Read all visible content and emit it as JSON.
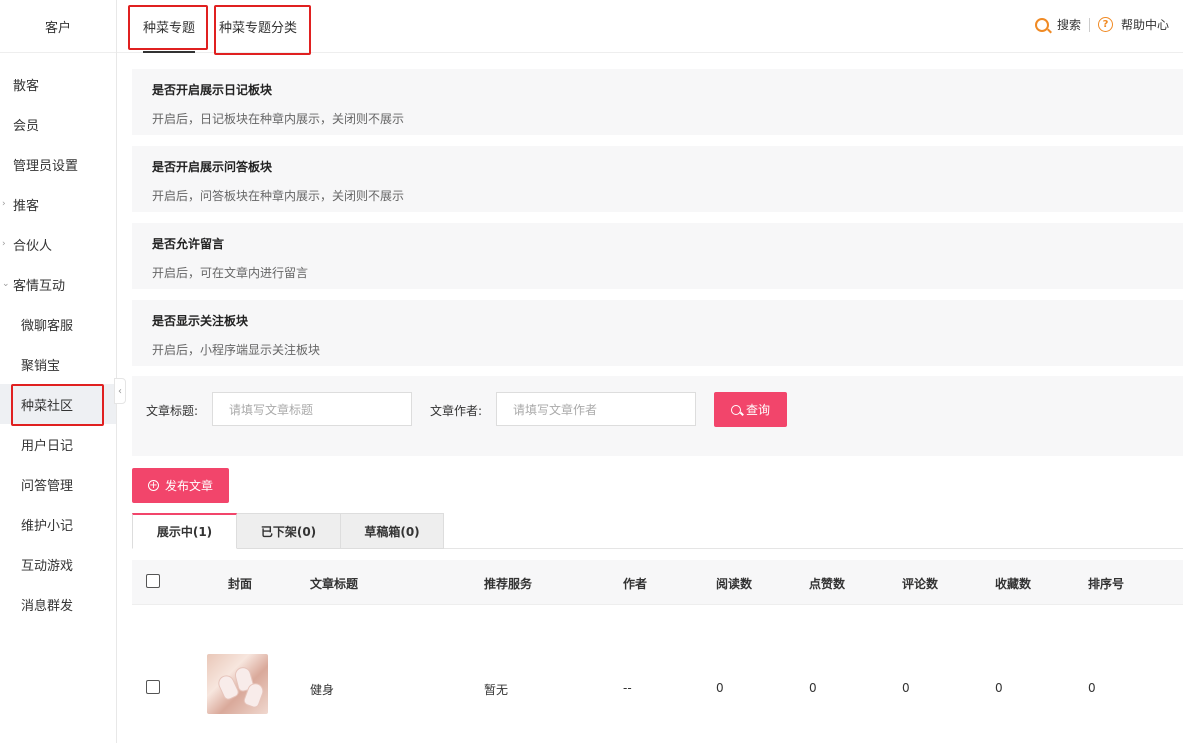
{
  "sidebar": {
    "title": "客户",
    "items": [
      {
        "label": "散客"
      },
      {
        "label": "会员"
      },
      {
        "label": "管理员设置"
      },
      {
        "label": "推客"
      },
      {
        "label": "合伙人"
      },
      {
        "label": "客情互动"
      },
      {
        "label": "微聊客服"
      },
      {
        "label": "聚销宝"
      },
      {
        "label": "种菜社区"
      },
      {
        "label": "用户日记"
      },
      {
        "label": "问答管理"
      },
      {
        "label": "维护小记"
      },
      {
        "label": "互动游戏"
      },
      {
        "label": "消息群发"
      }
    ]
  },
  "topbar": {
    "tabs": [
      {
        "label": "种菜专题"
      },
      {
        "label": "种菜专题分类"
      }
    ],
    "search_label": "搜索",
    "help_label": "帮助中心"
  },
  "settings": [
    {
      "title": "是否开启展示日记板块",
      "desc": "开启后，日记板块在种章内展示，关闭则不展示"
    },
    {
      "title": "是否开启展示问答板块",
      "desc": "开启后，问答板块在种章内展示，关闭则不展示"
    },
    {
      "title": "是否允许留言",
      "desc": "开启后，可在文章内进行留言"
    },
    {
      "title": "是否显示关注板块",
      "desc": "开启后，小程序端显示关注板块"
    }
  ],
  "search": {
    "title_label": "文章标题:",
    "title_placeholder": "请填写文章标题",
    "author_label": "文章作者:",
    "author_placeholder": "请填写文章作者",
    "query_label": "查询"
  },
  "publish_label": "发布文章",
  "tabs": [
    {
      "label": "展示中(1)"
    },
    {
      "label": "已下架(0)"
    },
    {
      "label": "草稿箱(0)"
    }
  ],
  "table": {
    "headers": [
      "封面",
      "文章标题",
      "推荐服务",
      "作者",
      "阅读数",
      "点赞数",
      "评论数",
      "收藏数",
      "排序号"
    ],
    "rows": [
      {
        "title": "健身",
        "service": "暂无",
        "author": "--",
        "reads": "0",
        "likes": "0",
        "comments": "0",
        "favorites": "0",
        "sort": "0"
      }
    ]
  },
  "colors": {
    "accent": "#f2456b",
    "icon": "#f08a24",
    "annotation": "#e02020"
  }
}
